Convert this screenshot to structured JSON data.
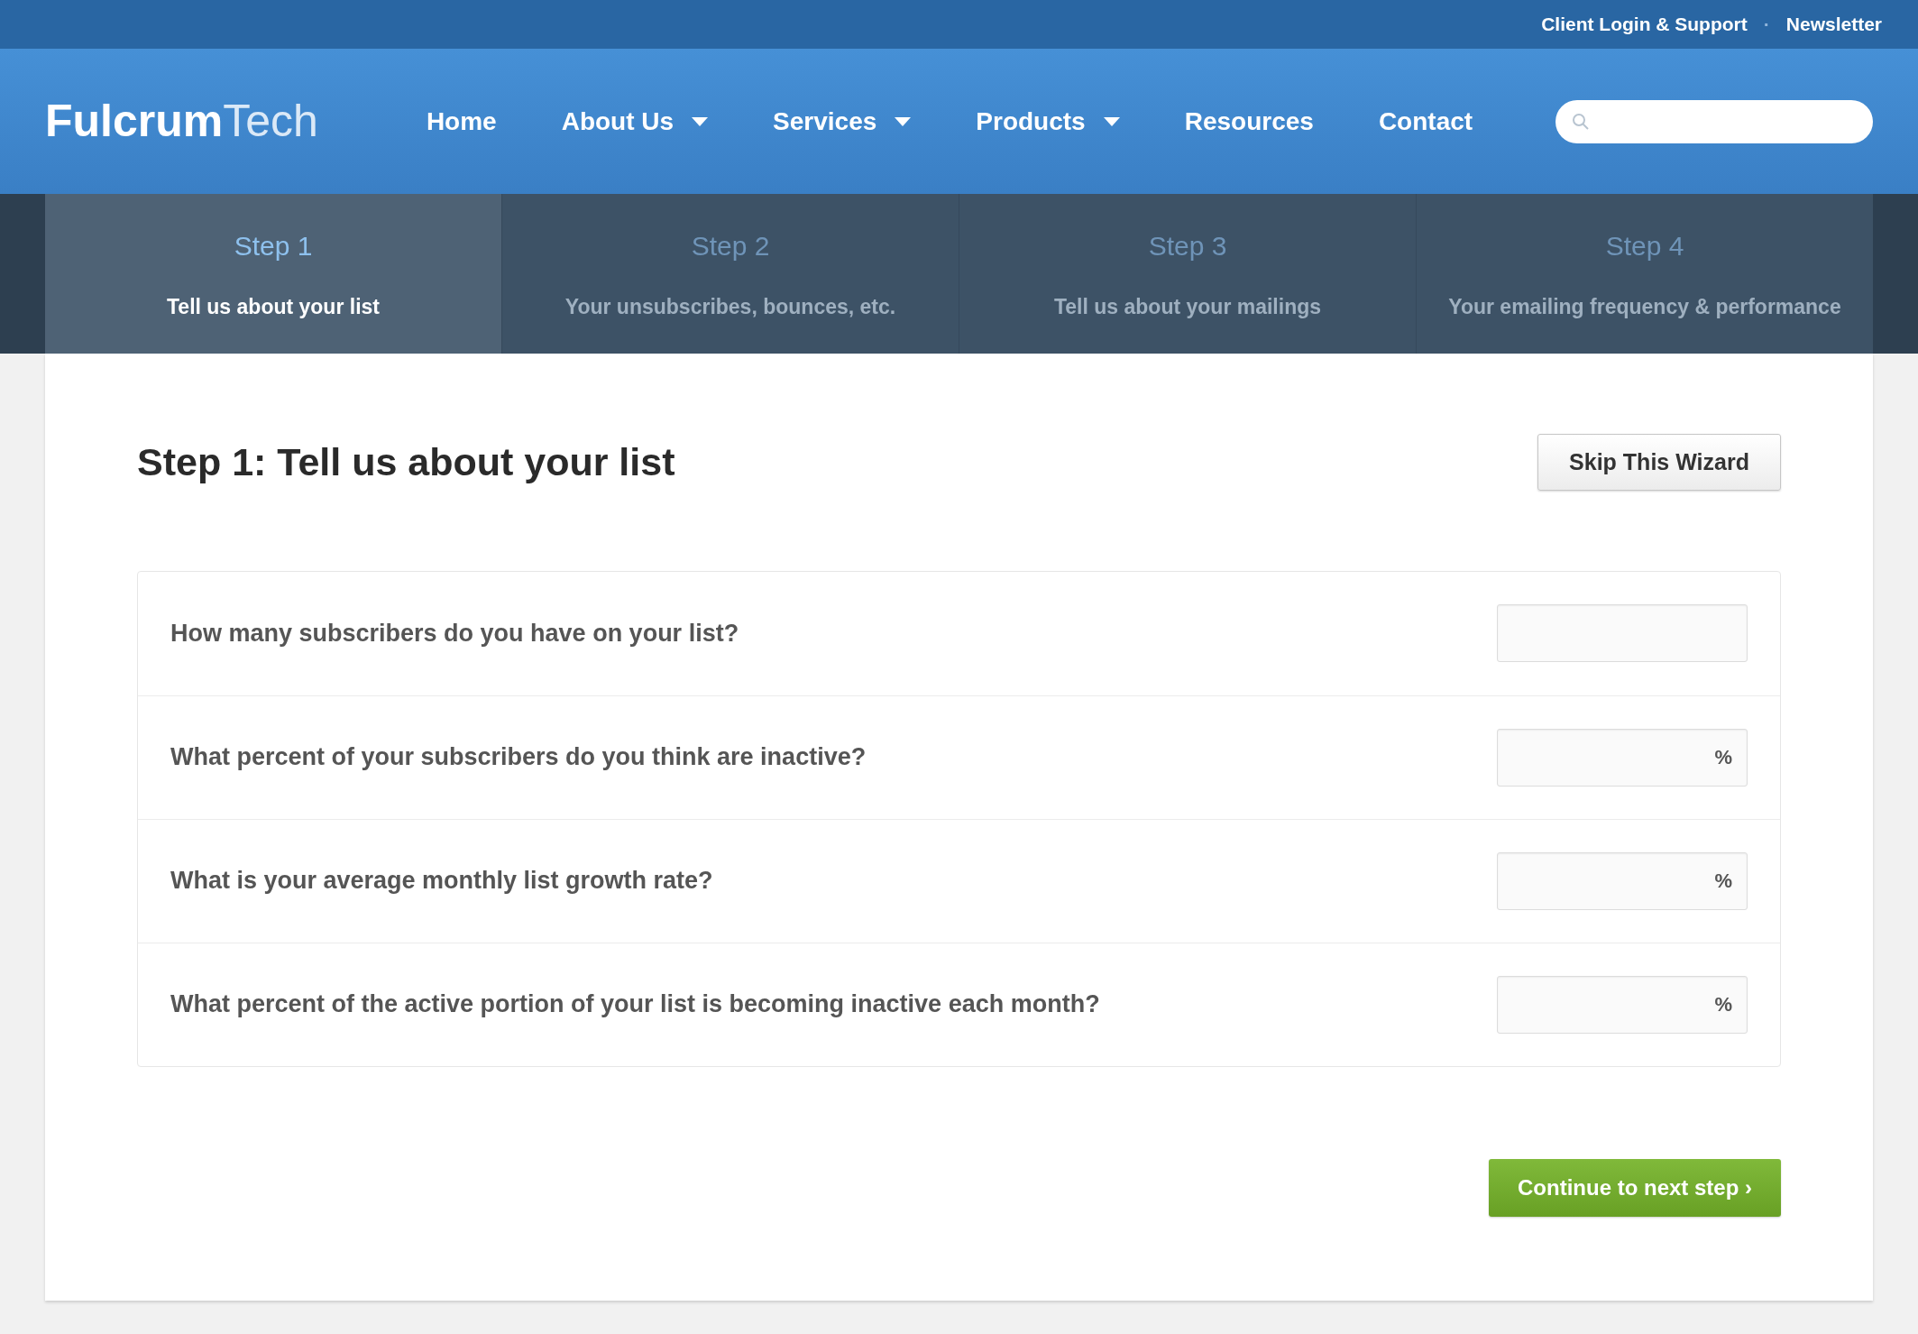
{
  "top_links": [
    "Client Login & Support",
    "Newsletter"
  ],
  "top_separator": "·",
  "logo": {
    "bold": "Fulcrum",
    "light": "Tech"
  },
  "nav": [
    {
      "label": "Home",
      "dropdown": false
    },
    {
      "label": "About Us",
      "dropdown": true
    },
    {
      "label": "Services",
      "dropdown": true
    },
    {
      "label": "Products",
      "dropdown": true
    },
    {
      "label": "Resources",
      "dropdown": false
    },
    {
      "label": "Contact",
      "dropdown": false
    }
  ],
  "steps": [
    {
      "title": "Step 1",
      "description": "Tell us about your list",
      "selected": true
    },
    {
      "title": "Step 2",
      "description": "Your unsubscribes, bounces, etc.",
      "selected": false
    },
    {
      "title": "Step 3",
      "description": "Tell us about your mailings",
      "selected": false
    },
    {
      "title": "Step 4",
      "description": "Your emailing frequency & performance",
      "selected": false
    }
  ],
  "heading": "Step 1: Tell us about your list",
  "skip_button": "Skip This Wizard",
  "questions": [
    {
      "label": "How many subscribers do you have on your list?"
    },
    {
      "label": "What percent of your subscribers do you think are inactive?",
      "unit": "%"
    },
    {
      "label": "What is your average monthly list growth rate?",
      "unit": "%"
    },
    {
      "label": "What percent of the active portion of your list is becoming inactive each month?",
      "unit": "%"
    }
  ],
  "continue_button": "Continue to next step ›"
}
